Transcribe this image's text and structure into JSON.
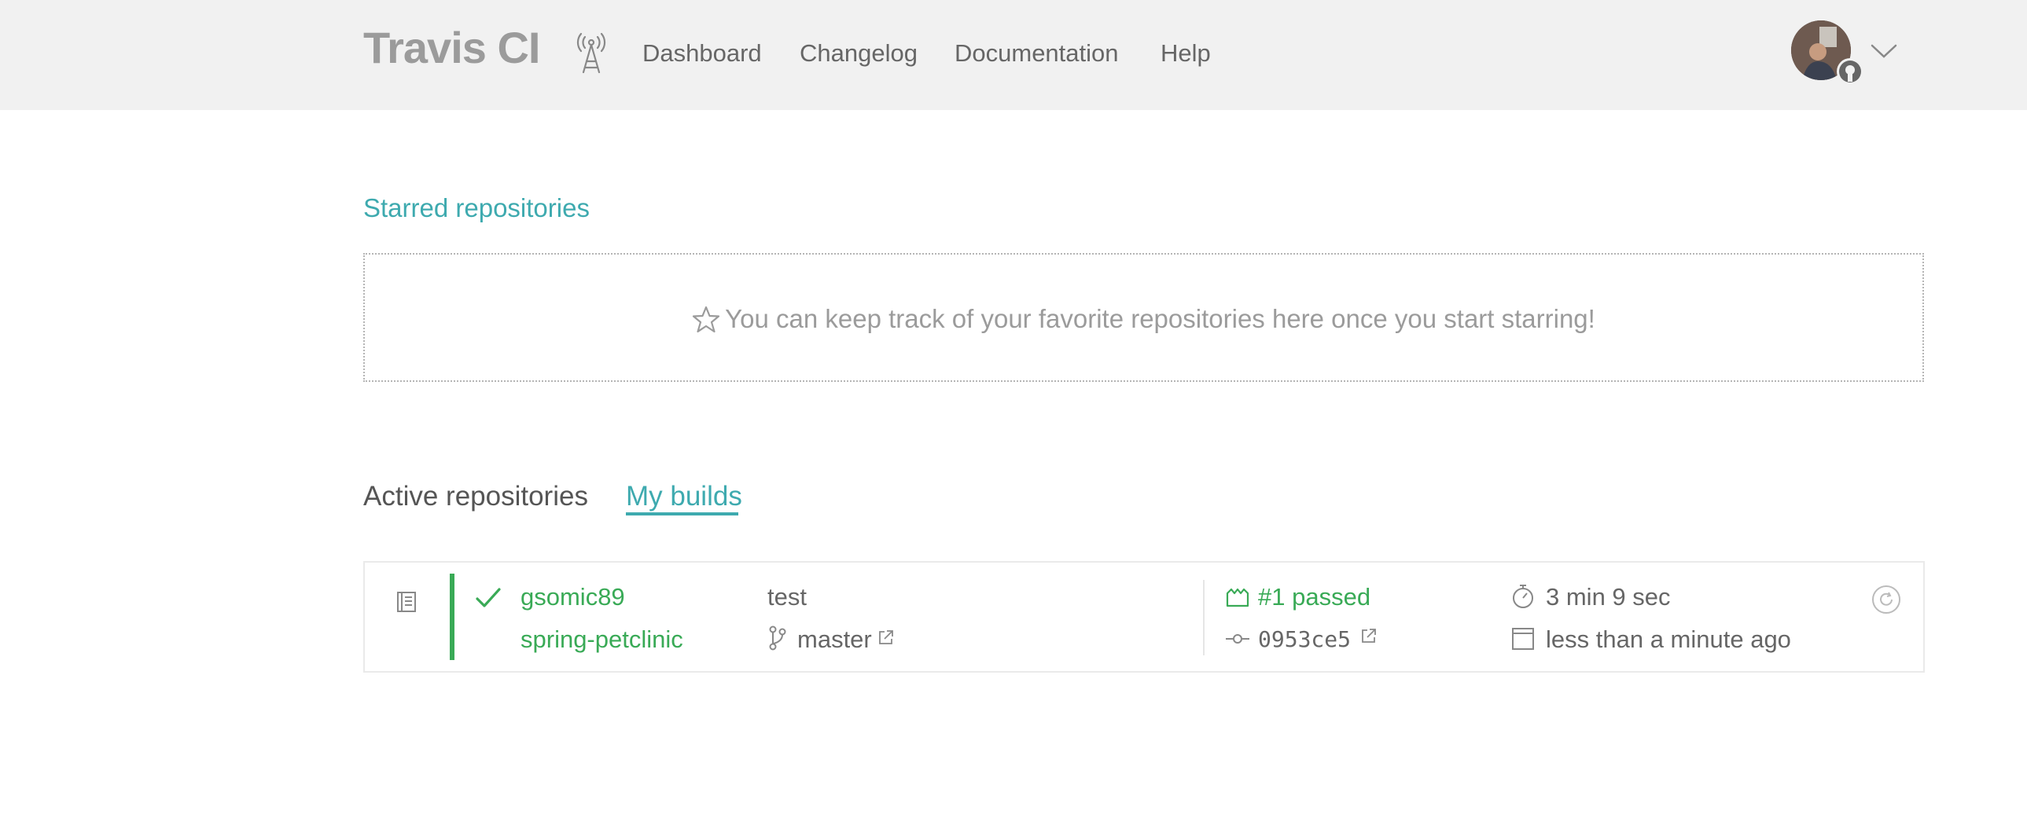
{
  "header": {
    "brand": "Travis CI",
    "broadcast_icon": "broadcast-tower-icon",
    "nav": [
      {
        "label": "Dashboard"
      },
      {
        "label": "Changelog"
      },
      {
        "label": "Documentation"
      },
      {
        "label": "Help"
      }
    ],
    "avatar_icon": "user-avatar",
    "account_badge_icon": "github-icon",
    "menu_icon": "chevron-down-icon"
  },
  "starred": {
    "title": "Starred repositories",
    "empty_message": "You can keep track of your favorite repositories here once you start starring!",
    "icon": "star-icon"
  },
  "tabs": [
    {
      "label": "Active repositories",
      "active": false
    },
    {
      "label": "My builds",
      "active": true
    }
  ],
  "builds": [
    {
      "owner": "gsomic89",
      "repo": "spring-petclinic",
      "commit_message": "test",
      "branch": "master",
      "build_status": "#1 passed",
      "commit_sha": "0953ce5",
      "duration": "3 min 9 sec",
      "finished": "less than a minute ago",
      "icons": [
        "repo-icon",
        "check-icon",
        "branch-icon",
        "external-link-icon",
        "build-icon",
        "commit-icon",
        "stopwatch-icon",
        "calendar-icon",
        "restart-icon"
      ]
    }
  ],
  "colors": {
    "accent": "#3eaaaf",
    "passed": "#39aa56",
    "header_bg": "#f1f1f1",
    "brand_text": "#9b9b9b"
  }
}
